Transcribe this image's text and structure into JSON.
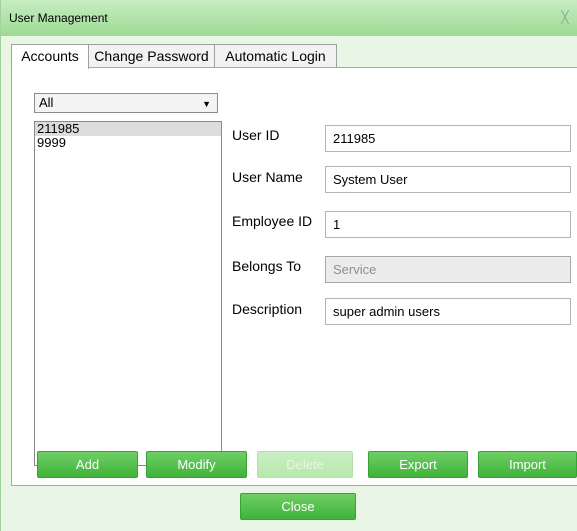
{
  "window": {
    "title": "User Management",
    "close_glyph": "╳"
  },
  "tabs": [
    {
      "label": "Accounts",
      "active": true
    },
    {
      "label": "Change Password",
      "active": false
    },
    {
      "label": "Automatic Login",
      "active": false
    }
  ],
  "filter": {
    "selected": "All"
  },
  "accounts": [
    "211985",
    "9999"
  ],
  "selected_account": "211985",
  "form": {
    "user_id": {
      "label": "User ID",
      "value": "211985"
    },
    "user_name": {
      "label": "User Name",
      "value": "System User"
    },
    "employee_id": {
      "label": "Employee ID",
      "value": "1"
    },
    "belongs_to": {
      "label": "Belongs To",
      "value": "Service"
    },
    "description": {
      "label": "Description",
      "value": "super admin users"
    }
  },
  "buttons": {
    "add": "Add",
    "modify": "Modify",
    "delete": "Delete",
    "export": "Export",
    "import": "Import",
    "close": "Close"
  },
  "colors": {
    "accent": "#3fb33a",
    "titlebar": "#9cdb93",
    "window_bg": "#e9f6e6"
  }
}
